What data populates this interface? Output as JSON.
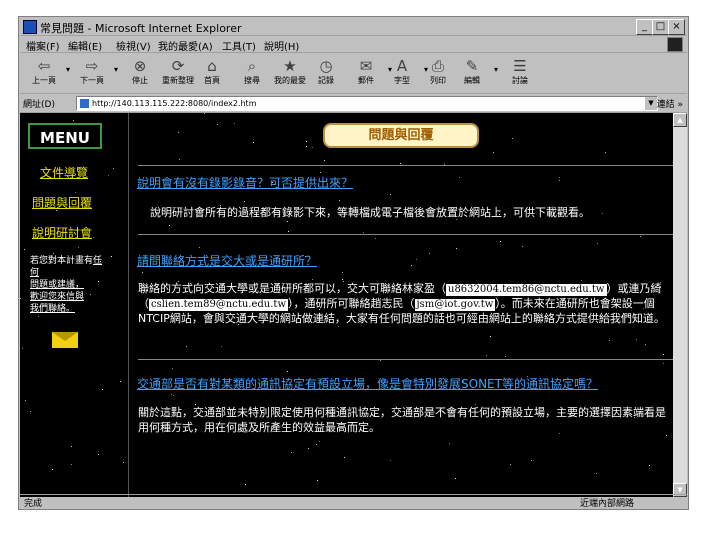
{
  "window": {
    "title": "常見問題 - Microsoft Internet Explorer",
    "controls": [
      "_",
      "□",
      "×"
    ]
  },
  "menubar": [
    "檔案(F)",
    "編輯(E)",
    "檢視(V)",
    "我的最愛(A)",
    "工具(T)",
    "說明(H)"
  ],
  "toolbar": [
    {
      "label": "上一頁",
      "icon": "back-icon",
      "glyph": "⇦"
    },
    {
      "label": "下一頁",
      "icon": "forward-icon",
      "glyph": "⇨"
    },
    {
      "label": "停止",
      "icon": "stop-icon",
      "glyph": "⊗"
    },
    {
      "label": "重新整理",
      "icon": "refresh-icon",
      "glyph": "⟳"
    },
    {
      "label": "首頁",
      "icon": "home-icon",
      "glyph": "⌂"
    },
    {
      "label": "搜尋",
      "icon": "search-icon",
      "glyph": "⌕"
    },
    {
      "label": "我的最愛",
      "icon": "favorites-icon",
      "glyph": "★"
    },
    {
      "label": "記錄",
      "icon": "history-icon",
      "glyph": "◷"
    },
    {
      "label": "郵件",
      "icon": "mail-icon",
      "glyph": "✉"
    },
    {
      "label": "字型",
      "icon": "font-icon",
      "glyph": "A"
    },
    {
      "label": "列印",
      "icon": "print-icon",
      "glyph": "⎙"
    },
    {
      "label": "編輯",
      "icon": "edit-icon",
      "glyph": "✎"
    },
    {
      "label": "討論",
      "icon": "discuss-icon",
      "glyph": "☰"
    }
  ],
  "address": {
    "label": "網址(D)",
    "value": "http://140.113.115.222:8080/index2.htm",
    "links": "連結 »"
  },
  "status": {
    "text": "完成",
    "zone": "近端內部網路"
  },
  "nav": {
    "menu_label": "MENU",
    "links": [
      "文件導覽",
      "問題與回覆",
      "說明研討會"
    ],
    "note": [
      "若您對本計畫有",
      "任何",
      "問題或建議，",
      "歡迎您來信與",
      "我們聯絡。"
    ]
  },
  "page": {
    "header": "問題與回覆",
    "qa": [
      {
        "q": "說明會有沒有錄影錄音？可否提供出來？",
        "a": "說明研討會所有的過程都有錄影下來，等轉檔成電子檔後會放置於網站上，可供下載觀看。"
      },
      {
        "q": "請問聯絡方式是交大或是通研所？",
        "a_parts": [
          "聯絡的方式向交通大學或是通研所都可以，交大可聯絡林家盈（",
          "u8632004.tem86@nctu.edu.tw",
          "）或連乃綺（",
          "cslien.tem89@nctu.edu.tw",
          "），通研所可聯絡趙志民（",
          "jsm@iot.gov.tw",
          "）。而未來在通研所也會架設一個NTCIP網站，會與交通大學的網站做連結，大家有任何問題的話也可經由網站上的聯絡方式提供給我們知道。"
        ]
      },
      {
        "q": "交通部是否有對某類的通訊協定有預設立場，像是會特別發展SONET等的通訊協定嗎？",
        "a": "關於這點，交通部並未特別限定使用何種通訊協定，交通部是不會有任何的預設立場，主要的選擇因素端看是用何種方式，用在何處及所產生的效益最高而定。"
      }
    ]
  }
}
